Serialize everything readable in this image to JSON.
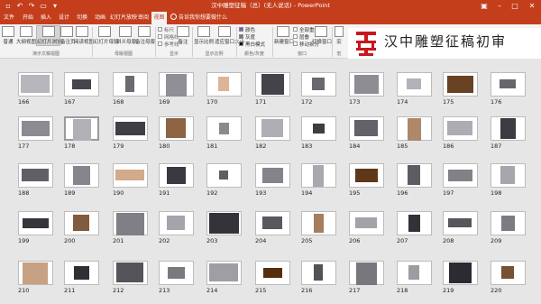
{
  "titlebar": {
    "title": "汉中雕塑征稿（总）(无人说话) - PowerPoint",
    "quick_access": [
      "save-icon",
      "undo-icon",
      "redo-icon",
      "start-slideshow-icon",
      "customize-icon"
    ],
    "window_controls": [
      "ribbon-display-options-icon",
      "minimize-icon",
      "maximize-icon",
      "close-icon"
    ]
  },
  "tabs": [
    "文件",
    "开始",
    "插入",
    "设计",
    "切换",
    "动画",
    "幻灯片放映",
    "审阅",
    "视图"
  ],
  "active_tab": "视图",
  "tell_me": "告诉我你想要做什么",
  "ribbon": {
    "buttons": [
      "普通",
      "大纲视图",
      "幻灯片浏览",
      "备注页",
      "阅读视图",
      "幻灯片母版",
      "讲义母版",
      "备注母版",
      "显示比例",
      "适应窗口大小",
      "新建窗口",
      "切换窗口",
      "宏"
    ],
    "show_items": [
      "标尺",
      "网格线",
      "参考线",
      "备注"
    ],
    "color_items": [
      {
        "label": "颜色",
        "color": "#7b5ea7"
      },
      {
        "label": "灰度",
        "color": "#777777"
      },
      {
        "label": "黑白模式",
        "color": "#111111"
      }
    ],
    "window_items": [
      "全部重排",
      "层叠",
      "移动拆分"
    ],
    "groups": [
      "演示文稿视图",
      "母版视图",
      "显示",
      "显示比例",
      "颜色/灰度",
      "窗口",
      "宏"
    ]
  },
  "banner": {
    "text": "汉中雕塑征稿初审",
    "logo_color": "#c8161d"
  },
  "slides": {
    "selected": 178,
    "rows": [
      [
        "166",
        "167",
        "168",
        "169",
        "170",
        "171",
        "172",
        "173",
        "174",
        "175",
        "176"
      ],
      [
        "177",
        "178",
        "179",
        "180",
        "181",
        "182",
        "183",
        "184",
        "185",
        "186",
        "187"
      ],
      [
        "188",
        "189",
        "190",
        "191",
        "192",
        "193",
        "194",
        "195",
        "196",
        "197",
        "198"
      ],
      [
        "199",
        "200",
        "201",
        "202",
        "203",
        "204",
        "205",
        "206",
        "207",
        "208",
        "209"
      ],
      [
        "210",
        "211",
        "212",
        "213",
        "214",
        "215",
        "216",
        "217",
        "218",
        "219",
        "220"
      ]
    ]
  }
}
